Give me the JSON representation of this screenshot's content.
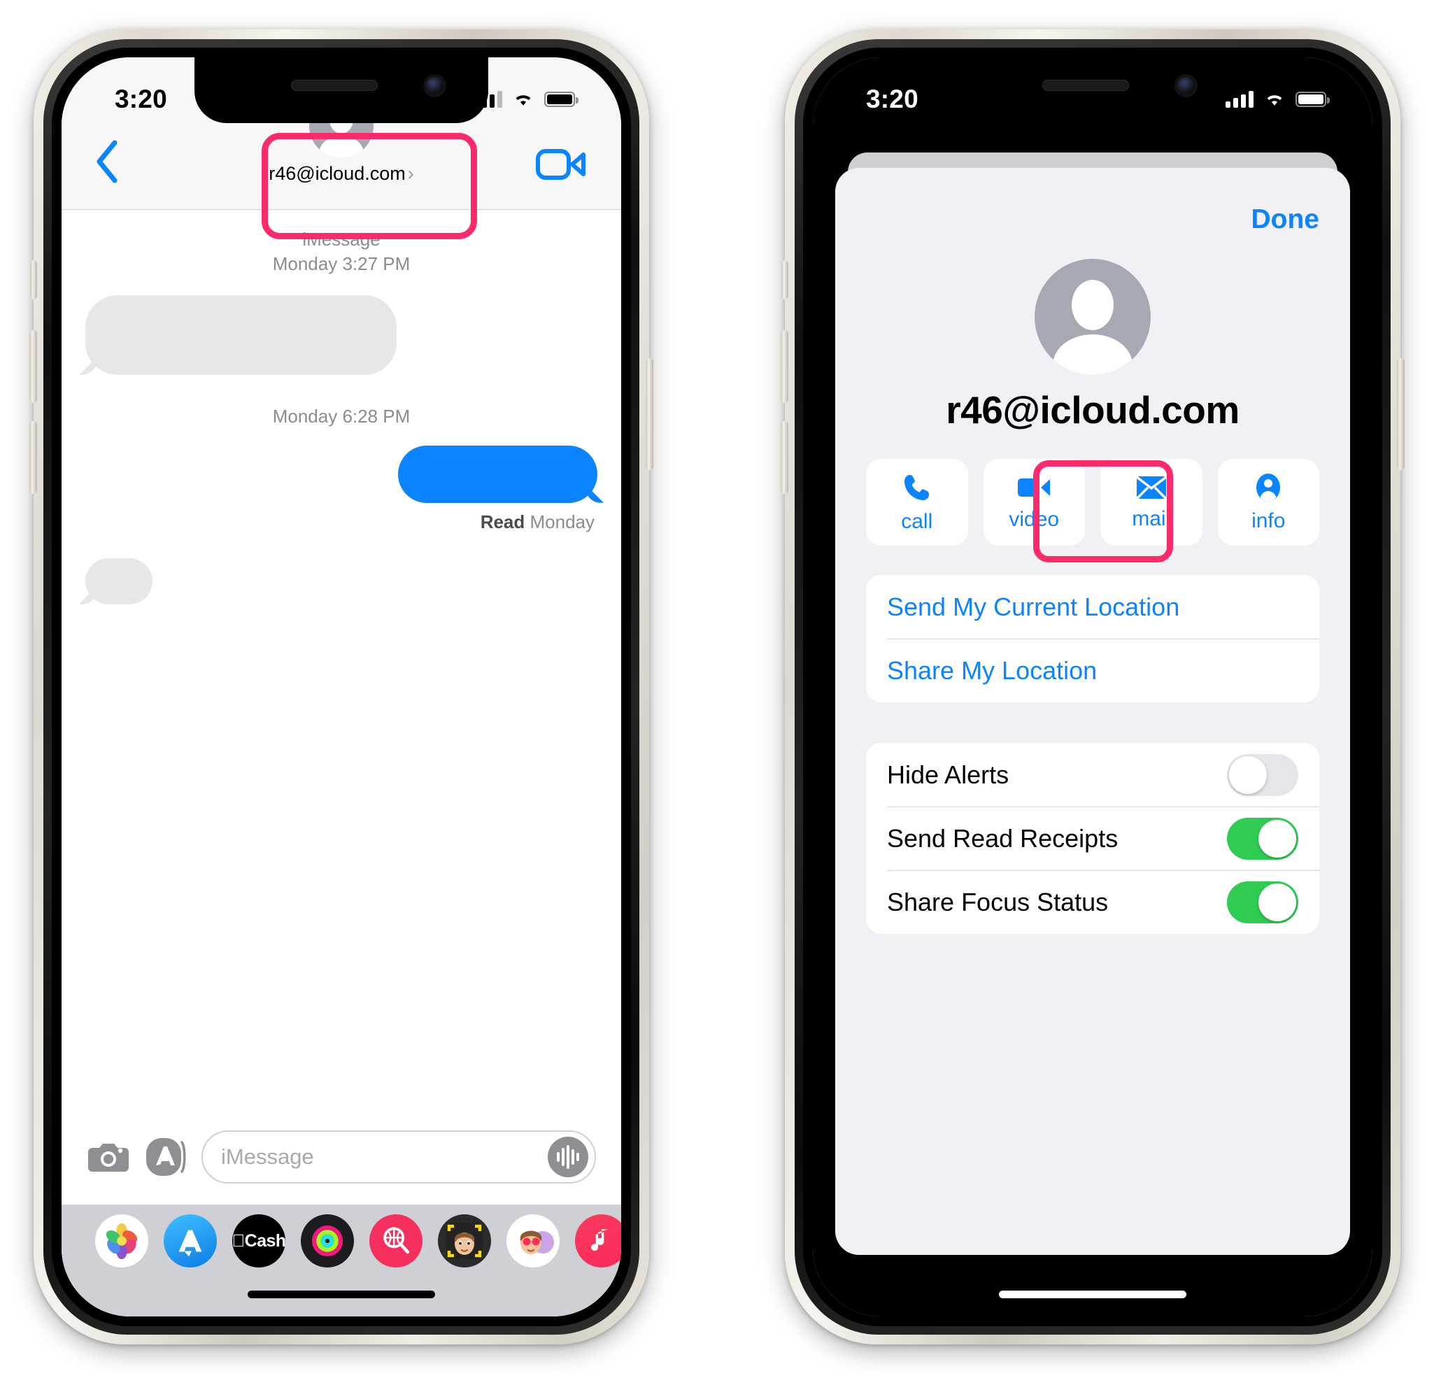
{
  "left_phone": {
    "status": {
      "time": "3:20",
      "signal_icon": "cellular-bars-icon",
      "wifi_icon": "wifi-icon",
      "battery_icon": "battery-icon"
    },
    "navbar": {
      "back_icon": "chevron-left-icon",
      "video_icon": "video-camera-icon",
      "contact_name": "r46@icloud.com",
      "contact_chevron": "›",
      "avatar_icon": "person-avatar-icon"
    },
    "thread": {
      "service_label": "iMessage",
      "first_timestamp": "Monday 3:27 PM",
      "second_timestamp": "Monday 6:28 PM",
      "read_prefix": "Read",
      "read_value": "Monday"
    },
    "input_bar": {
      "camera_icon": "camera-icon",
      "apps_icon": "app-store-icon",
      "placeholder": "iMessage",
      "mic_icon": "audio-waveform-icon"
    },
    "app_drawer": [
      {
        "name": "photos-app-icon",
        "label": ""
      },
      {
        "name": "app-store-app-icon",
        "label": ""
      },
      {
        "name": "apple-cash-app-icon",
        "label": "Cash"
      },
      {
        "name": "fitness-rings-app-icon",
        "label": ""
      },
      {
        "name": "image-search-app-icon",
        "label": ""
      },
      {
        "name": "memoji-app-icon",
        "label": ""
      },
      {
        "name": "memoji-stickers-app-icon",
        "label": ""
      },
      {
        "name": "music-app-icon",
        "label": ""
      }
    ]
  },
  "right_phone": {
    "status": {
      "time": "3:20",
      "signal_icon": "cellular-bars-icon",
      "wifi_icon": "wifi-icon",
      "battery_icon": "battery-icon"
    },
    "sheet": {
      "done_label": "Done",
      "avatar_icon": "person-avatar-icon",
      "contact_title": "r46@icloud.com",
      "actions": [
        {
          "label": "call",
          "icon": "phone-icon"
        },
        {
          "label": "video",
          "icon": "video-camera-icon"
        },
        {
          "label": "mail",
          "icon": "envelope-icon"
        },
        {
          "label": "info",
          "icon": "person-circle-icon"
        }
      ],
      "location_links": [
        {
          "label": "Send My Current Location"
        },
        {
          "label": "Share My Location"
        }
      ],
      "toggles": [
        {
          "label": "Hide Alerts",
          "state": "off"
        },
        {
          "label": "Send Read Receipts",
          "state": "on"
        },
        {
          "label": "Share Focus Status",
          "state": "on"
        }
      ]
    }
  },
  "annotations": {
    "highlight_color": "#fb2a6b",
    "highlight_targets": [
      "contact-header-button",
      "info-action-button"
    ]
  },
  "colors": {
    "accent_blue": "#0b84ff",
    "toggle_green": "#2fcc52",
    "bubble_gray": "#e7e7e9",
    "sheet_bg": "#f1f1f5",
    "navbar_bg": "#f7f7f7",
    "drawer_bg": "#ced0d6"
  }
}
